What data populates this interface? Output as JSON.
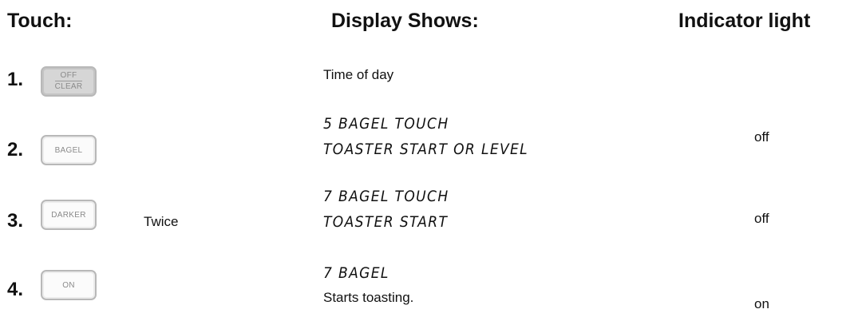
{
  "headers": {
    "touch": "Touch:",
    "display": "Display Shows:",
    "indicator": "Indicator light"
  },
  "steps": [
    {
      "number": "1.",
      "key_line1": "OFF",
      "key_line2": "CLEAR",
      "display_text": "Time of day",
      "indicator": ""
    },
    {
      "number": "2.",
      "key": "BAGEL",
      "display_line1": "5 BAGEL TOUCH",
      "display_line2": "TOASTER START OR LEVEL",
      "indicator": "off"
    },
    {
      "number": "3.",
      "key": "DARKER",
      "note": "Twice",
      "display_line1": "7 BAGEL TOUCH",
      "display_line2": "TOASTER START",
      "indicator": "off"
    },
    {
      "number": "4.",
      "key": "ON",
      "display_line1": "7 BAGEL",
      "display_line2": "Starts toasting.",
      "indicator": "on"
    }
  ]
}
